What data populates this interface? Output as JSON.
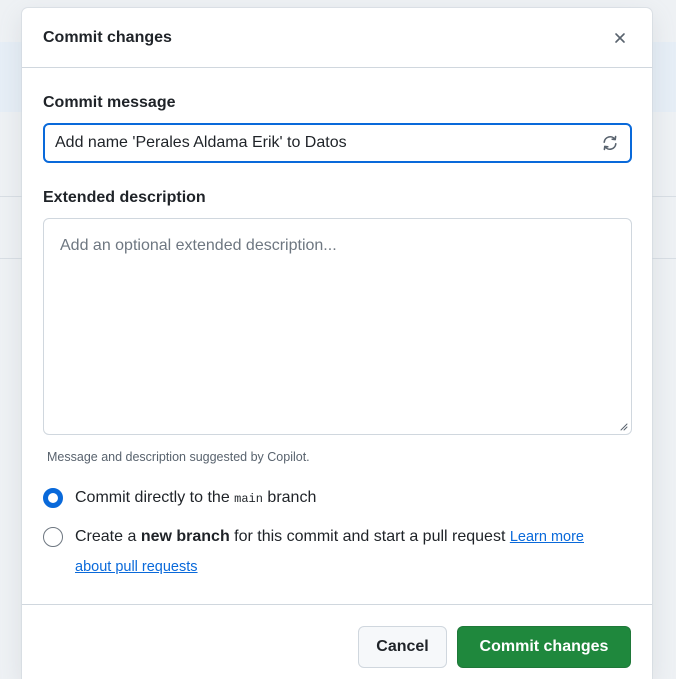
{
  "dialog": {
    "title": "Commit changes",
    "close_icon": "close-icon"
  },
  "commit_message": {
    "label": "Commit message",
    "value": "Add name 'Perales Aldama Erik' to Datos",
    "refresh_icon": "sync-icon"
  },
  "extended_description": {
    "label": "Extended description",
    "placeholder": "Add an optional extended description...",
    "value": ""
  },
  "hint": "Message and description suggested by Copilot.",
  "branch_options": {
    "direct": {
      "selected": true,
      "prefix": "Commit directly to the ",
      "branch": "main",
      "suffix": " branch"
    },
    "new_branch": {
      "selected": false,
      "prefix": "Create a ",
      "bold": "new branch",
      "suffix": " for this commit and start a pull request ",
      "link": "Learn more about pull requests"
    }
  },
  "footer": {
    "cancel_label": "Cancel",
    "commit_label": "Commit changes"
  },
  "colors": {
    "accent": "#0969da",
    "primary_button": "#1f883d",
    "border": "#d0d7de"
  }
}
